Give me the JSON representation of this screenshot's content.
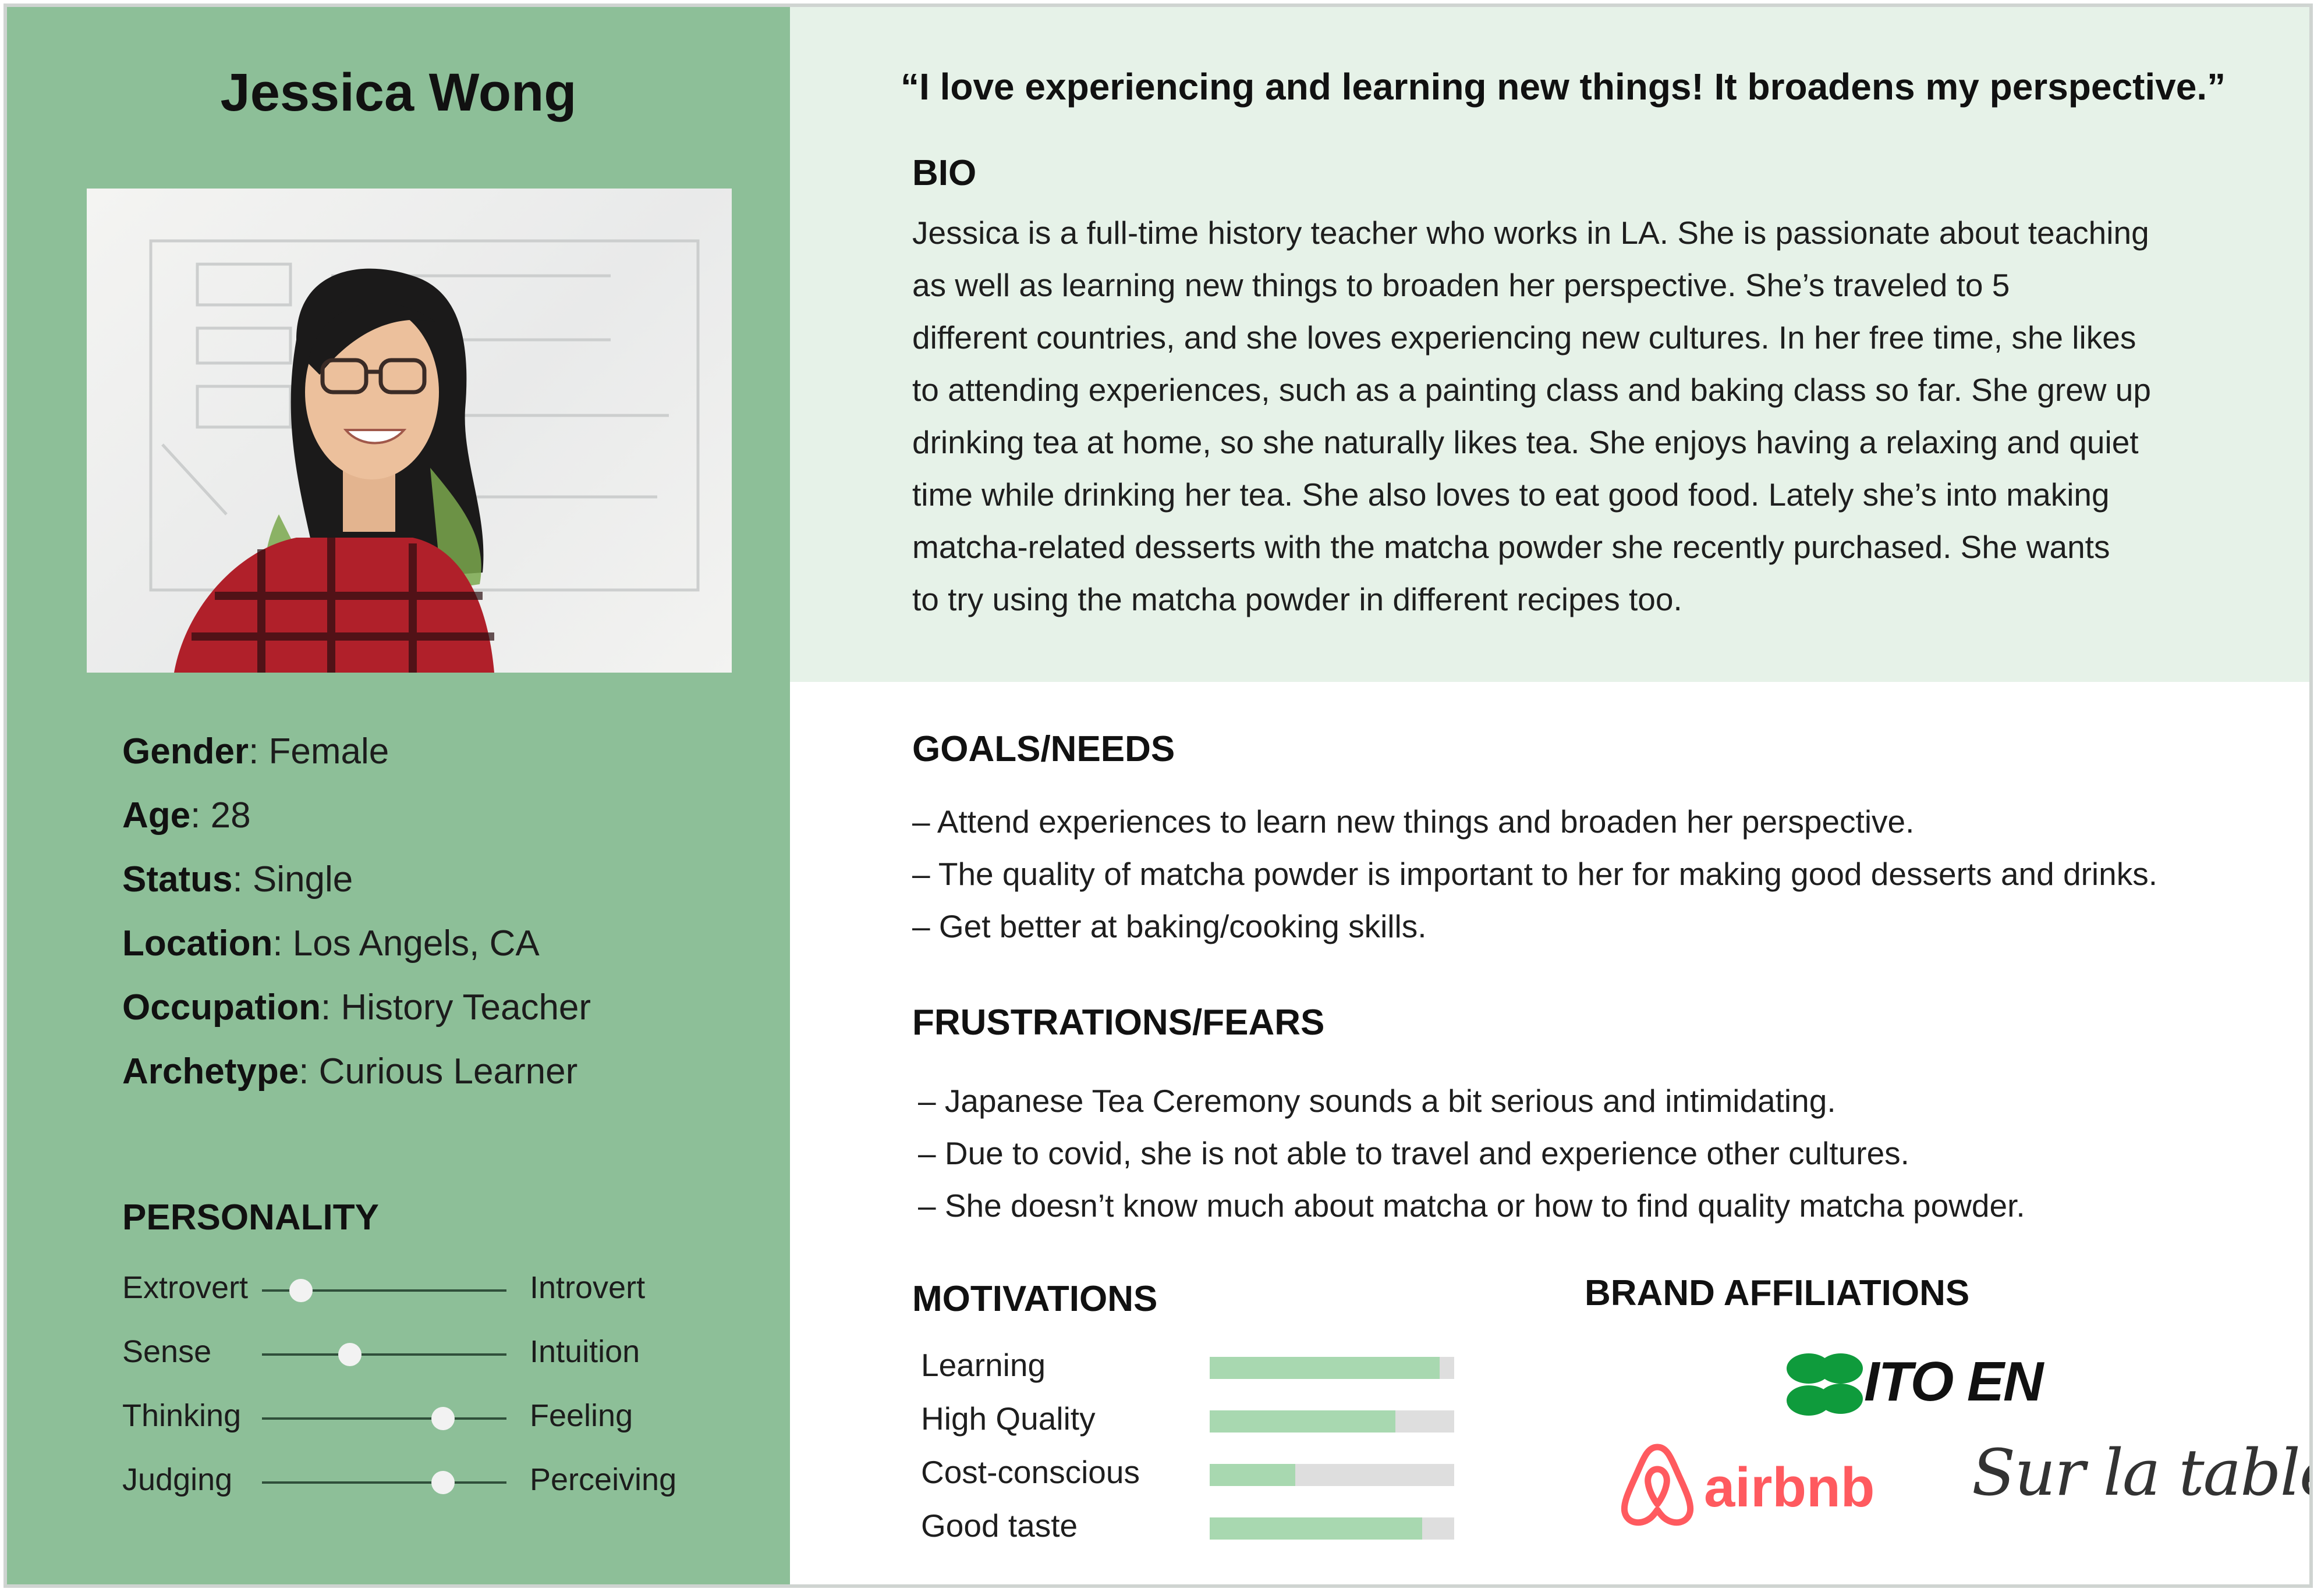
{
  "persona": {
    "name": "Jessica Wong",
    "photo_alt": "Portrait of Jessica Wong",
    "facts": [
      {
        "key": "Gender",
        "value": ": Female"
      },
      {
        "key": "Age",
        "value": ": 28"
      },
      {
        "key": "Status",
        "value": ": Single"
      },
      {
        "key": "Location",
        "value": ": Los Angels, CA"
      },
      {
        "key": "Occupation",
        "value": ": History Teacher"
      },
      {
        "key": "Archetype",
        "value": ": Curious Learner"
      }
    ]
  },
  "personality": {
    "title": "PERSONALITY",
    "sliders": [
      {
        "left": "Extrovert",
        "right": "Introvert",
        "value": 0.16
      },
      {
        "left": "Sense",
        "right": "Intuition",
        "value": 0.36
      },
      {
        "left": "Thinking",
        "right": "Feeling",
        "value": 0.74
      },
      {
        "left": "Judging",
        "right": "Perceiving",
        "value": 0.74
      }
    ]
  },
  "quote": "“I love experiencing and learning new things! It broadens my perspective.”",
  "bio": {
    "title": "BIO",
    "lines": [
      "Jessica is a full-time history teacher who works in LA. She is passionate about teaching",
      "as well as learning new things to broaden her perspective. She’s traveled to 5",
      "different countries, and she loves experiencing new cultures. In her free time, she likes",
      "to attending experiences, such as a painting class and baking class so far. She grew up",
      "drinking tea at home, so she naturally likes tea. She enjoys having a relaxing and quiet",
      "time while drinking her tea. She also loves to eat good food. Lately she’s into making",
      "matcha-related desserts with the matcha powder she recently purchased. She wants",
      "to try using the matcha powder in different recipes too."
    ]
  },
  "goals": {
    "title": "GOALS/NEEDS",
    "items": [
      "– Attend experiences to learn new things and broaden her perspective.",
      "– The quality of matcha powder is important to her for making good desserts and drinks.",
      "– Get better at baking/cooking skills."
    ]
  },
  "frustrations": {
    "title": "FRUSTRATIONS/FEARS",
    "items": [
      "– Japanese Tea Ceremony sounds a bit serious and intimidating.",
      "– Due to covid, she is not able to travel and experience other cultures.",
      "– She doesn’t know much about matcha or how to find quality matcha powder."
    ]
  },
  "motivations": {
    "title": "MOTIVATIONS",
    "items": [
      {
        "label": "Learning",
        "value": 0.94
      },
      {
        "label": "High Quality",
        "value": 0.76
      },
      {
        "label": "Cost-conscious",
        "value": 0.35
      },
      {
        "label": "Good taste",
        "value": 0.87
      }
    ]
  },
  "brands": {
    "title": "BRAND AFFILIATIONS",
    "logos": [
      {
        "name": "ITO EN",
        "color": "#0f9b3c"
      },
      {
        "name": "airbnb",
        "color": "#ff5a5f"
      },
      {
        "name": "Sur la table",
        "color": "#333333"
      }
    ]
  }
}
